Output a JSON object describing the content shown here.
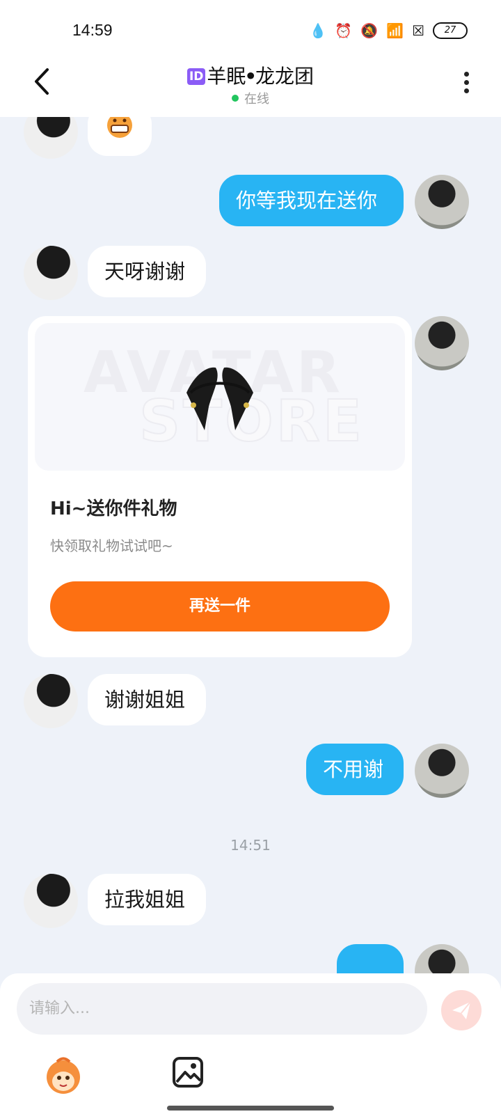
{
  "status_bar": {
    "time": "14:59",
    "battery": "27"
  },
  "header": {
    "id_badge": "ID",
    "title": "羊眠ꔷ龙龙团",
    "status": "在线"
  },
  "messages": [
    {
      "side": "in",
      "text": "你等我现在送你"
    },
    {
      "side": "in",
      "text": "天呀谢谢"
    },
    {
      "side": "in",
      "text": "谢谢姐姐"
    },
    {
      "side": "out",
      "text": "不用谢"
    },
    {
      "side": "in",
      "text": "拉我姐姐"
    }
  ],
  "chat": {
    "out_message_1": "你等我现在送你",
    "in_message_1": "天呀谢谢",
    "in_message_2": "谢谢姐姐",
    "out_message_2": "不用谢",
    "in_message_3": "拉我姐姐",
    "timestamp": "14:51"
  },
  "gift": {
    "watermark_line1": "AVATAR",
    "watermark_line2": "STORE",
    "title": "Hi~送你件礼物",
    "subtitle": "快领取礼物试试吧~",
    "button": "再送一件"
  },
  "input": {
    "placeholder": "请输入..."
  },
  "colors": {
    "outgoing_bubble": "#28b4f3",
    "gift_button": "#fd7012",
    "online": "#22c55e"
  }
}
